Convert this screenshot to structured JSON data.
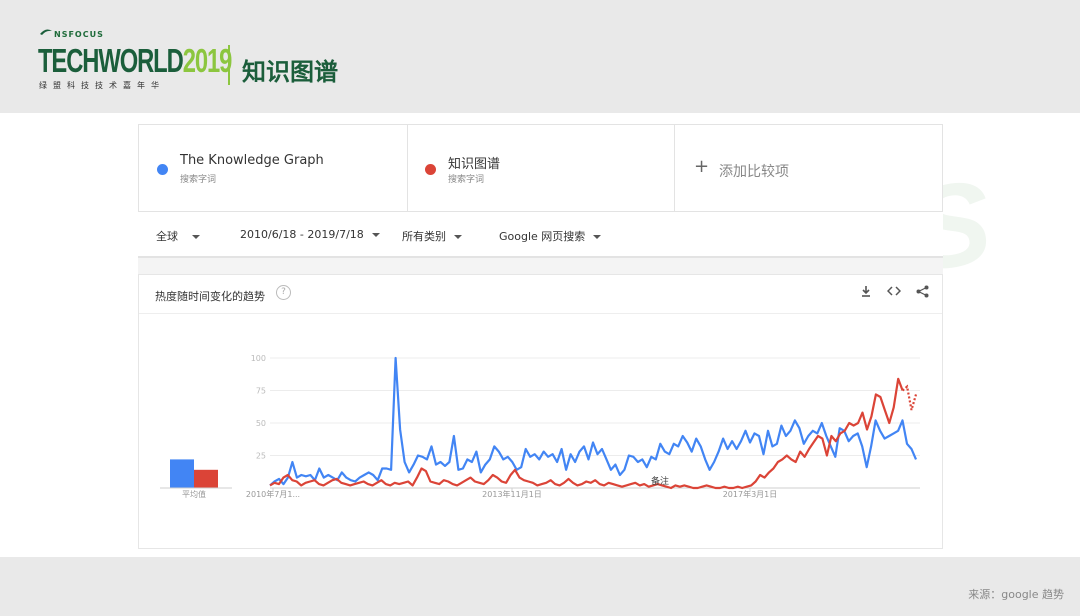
{
  "header": {
    "brand_small": "NSFOCUS",
    "brand_main": "TECHWORLD",
    "brand_year": "2019",
    "brand_sub": "绿盟科技技术嘉年华",
    "page_title": "知识图谱",
    "brand_color": "#1b5e3b",
    "accent_color": "#8cc63f"
  },
  "terms": [
    {
      "name": "The Knowledge Graph",
      "type": "搜索字词",
      "color": "#4285f4"
    },
    {
      "name": "知识图谱",
      "type": "搜索字词",
      "color": "#db4437"
    }
  ],
  "add_term": {
    "icon": "plus-icon",
    "label": "添加比较项"
  },
  "filters": {
    "region": "全球",
    "date_range": "2010/6/18 - 2019/7/18",
    "category": "所有类别",
    "search_type": "Google 网页搜索"
  },
  "panel": {
    "title": "热度随时间变化的趋势",
    "help_icon": "help-icon",
    "tools": [
      "download-icon",
      "embed-icon",
      "share-icon"
    ]
  },
  "watermark": "NSFOCUS",
  "footer": {
    "source": "来源：google 趋势"
  },
  "chart_data": {
    "type": "line",
    "average_label": "平均值",
    "averages": [
      22,
      14
    ],
    "ylim": [
      0,
      100
    ],
    "y_ticks": [
      "100",
      "75",
      "50",
      "25"
    ],
    "x_tick_labels": [
      "2010年7月1...",
      "2013年11月1日",
      "2017年3月1日"
    ],
    "annotation": "备注",
    "series": [
      {
        "name": "The Knowledge Graph",
        "color": "#4285f4",
        "values": [
          2,
          5,
          7,
          3,
          8,
          20,
          8,
          10,
          9,
          10,
          6,
          15,
          8,
          10,
          8,
          6,
          12,
          8,
          6,
          5,
          8,
          10,
          12,
          10,
          6,
          15,
          15,
          14,
          100,
          45,
          20,
          12,
          18,
          25,
          24,
          22,
          32,
          18,
          20,
          17,
          20,
          40,
          14,
          15,
          22,
          20,
          28,
          12,
          18,
          22,
          32,
          28,
          22,
          24,
          20,
          14,
          16,
          30,
          24,
          26,
          22,
          28,
          24,
          26,
          20,
          30,
          14,
          26,
          20,
          28,
          32,
          22,
          35,
          26,
          30,
          22,
          14,
          18,
          10,
          14,
          25,
          24,
          20,
          22,
          16,
          24,
          22,
          34,
          28,
          26,
          34,
          32,
          40,
          35,
          28,
          38,
          32,
          22,
          14,
          20,
          28,
          38,
          30,
          36,
          30,
          36,
          44,
          35,
          42,
          40,
          26,
          44,
          32,
          34,
          48,
          40,
          44,
          52,
          46,
          34,
          40,
          44,
          42,
          50,
          40,
          32,
          24,
          46,
          44,
          36,
          40,
          42,
          32,
          16,
          32,
          52,
          44,
          38,
          40,
          42,
          44,
          52,
          34,
          30,
          22
        ]
      },
      {
        "name": "知识图谱",
        "color": "#db4437",
        "values": [
          2,
          4,
          3,
          8,
          10,
          6,
          5,
          2,
          4,
          5,
          6,
          3,
          2,
          4,
          6,
          7,
          4,
          3,
          2,
          3,
          4,
          5,
          3,
          2,
          4,
          6,
          3,
          2,
          4,
          3,
          4,
          5,
          2,
          8,
          15,
          13,
          5,
          4,
          3,
          6,
          5,
          3,
          2,
          4,
          6,
          8,
          5,
          4,
          3,
          6,
          10,
          8,
          5,
          4,
          10,
          14,
          8,
          6,
          5,
          4,
          2,
          3,
          4,
          6,
          3,
          2,
          4,
          7,
          4,
          2,
          3,
          5,
          4,
          6,
          3,
          2,
          4,
          3,
          2,
          1,
          2,
          3,
          4,
          2,
          3,
          1,
          2,
          3,
          2,
          1,
          0,
          2,
          1,
          2,
          1,
          0,
          0,
          1,
          2,
          1,
          0,
          0,
          1,
          0,
          0,
          1,
          0,
          1,
          2,
          5,
          10,
          8,
          12,
          15,
          20,
          22,
          25,
          22,
          20,
          28,
          24,
          30,
          35,
          40,
          38,
          25,
          40,
          36,
          42,
          44,
          50,
          48,
          50,
          58,
          45,
          55,
          72,
          70,
          60,
          50,
          62,
          84,
          75,
          78,
          60,
          72
        ]
      }
    ]
  }
}
